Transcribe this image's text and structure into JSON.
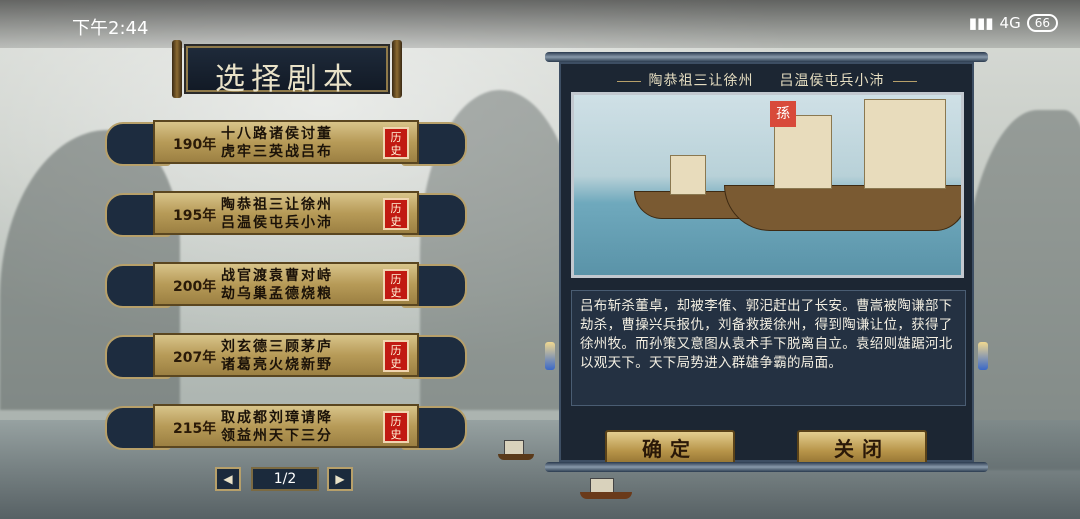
{
  "status_bar": {
    "time": "下午2:44",
    "network": "4G",
    "battery": "66"
  },
  "title": "选择剧本",
  "scenarios": [
    {
      "year": "190年",
      "line1": "十八路诸侯讨董",
      "line2": "虎牢三英战吕布",
      "stamp": "历史"
    },
    {
      "year": "195年",
      "line1": "陶恭祖三让徐州",
      "line2": "吕温侯屯兵小沛",
      "stamp": "历史"
    },
    {
      "year": "200年",
      "line1": "战官渡袁曹对峙",
      "line2": "劫乌巢孟德烧粮",
      "stamp": "历史"
    },
    {
      "year": "207年",
      "line1": "刘玄德三顾茅庐",
      "line2": "诸葛亮火烧新野",
      "stamp": "历史"
    },
    {
      "year": "215年",
      "line1": "取成都刘璋请降",
      "line2": "领益州天下三分",
      "stamp": "历史"
    }
  ],
  "pager": {
    "text": "1/2",
    "prev_icon": "left-triangle-icon",
    "next_icon": "right-triangle-icon"
  },
  "detail": {
    "header_left": "陶恭祖三让徐州",
    "header_right": "吕温侯屯兵小沛",
    "flag_text": "孫",
    "description": "吕布斩杀董卓，却被李傕、郭汜赶出了长安。曹嵩被陶谦部下劫杀，曹操兴兵报仇，刘备救援徐州，得到陶谦让位，获得了徐州牧。而孙策又意图从袁术手下脱离自立。袁绍则雄踞河北以观天下。天下局势进入群雄争霸的局面。",
    "confirm_label": "确定",
    "close_label": "关闭"
  }
}
